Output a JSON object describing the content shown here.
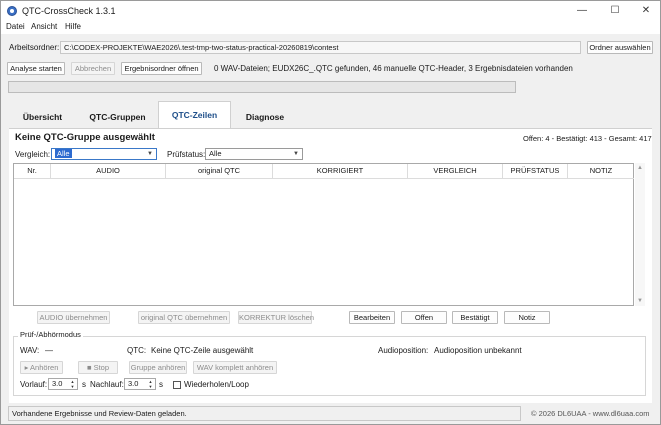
{
  "window": {
    "title": "QTC-CrossCheck 1.3.1",
    "controls": {
      "minimize": "—",
      "maximize": "☐",
      "close": "✕"
    }
  },
  "menu": [
    "Datei",
    "Ansicht",
    "Hilfe"
  ],
  "workdir": {
    "label": "Arbeitsordner:",
    "path": "C:\\CODEX-PROJEKTE\\WAE2026\\.test-tmp-two-status-practical-20260819\\contest",
    "choose_button": "Ordner auswählen"
  },
  "toolbar": {
    "start": "Analyse starten",
    "cancel": "Abbrechen",
    "open_results": "Ergebnisordner öffnen",
    "summary": "0 WAV-Dateien; EUDX26C_.QTC gefunden, 46 manuelle QTC-Header, 3 Ergebnisdateien vorhanden"
  },
  "progress": {
    "value": 0
  },
  "tabs": [
    {
      "label": "Übersicht",
      "active": false
    },
    {
      "label": "QTC-Gruppen",
      "active": false
    },
    {
      "label": "QTC-Zeilen",
      "active": true
    },
    {
      "label": "Diagnose",
      "active": false
    }
  ],
  "panel": {
    "heading": "Keine QTC-Gruppe ausgewählt",
    "counts": "Offen: 4 - Bestätigt: 413 - Gesamt: 417",
    "filter": {
      "compare_label": "Vergleich:",
      "compare_value": "Alle",
      "status_label": "Prüfstatus:",
      "status_value": "Alle"
    },
    "columns": [
      "Nr.",
      "AUDIO",
      "original QTC",
      "KORRIGIERT",
      "VERGLEICH",
      "PRÜFSTATUS",
      "NOTIZ"
    ],
    "rows": []
  },
  "actions": {
    "take_audio": "AUDIO übernehmen",
    "take_original": "original QTC übernehmen",
    "clear_correction": "KORREKTUR löschen",
    "edit": "Bearbeiten",
    "open": "Offen",
    "confirm": "Bestätigt",
    "note": "Notiz"
  },
  "listen": {
    "group_title": "Prüf-/Abhörmodus",
    "wav_label": "WAV:",
    "wav_value": "—",
    "qtc_label": "QTC:",
    "qtc_value": "Keine QTC-Zeile ausgewählt",
    "audiopos_label": "Audioposition:",
    "audiopos_value": "Audioposition unbekannt",
    "play": "Anhören",
    "stop": "Stop",
    "play_group": "Gruppe anhören",
    "play_wav": "WAV komplett anhören",
    "pre_label": "Vorlauf:",
    "pre_value": "3.0",
    "pre_unit": "s",
    "post_label": "Nachlauf:",
    "post_value": "3.0",
    "post_unit": "s",
    "repeat_label": "Wiederholen/Loop",
    "repeat_checked": false
  },
  "status": {
    "message": "Vorhandene Ergebnisse und Review-Daten geladen.",
    "copyright": "© 2026 DL6UAA - www.dl6uaa.com"
  }
}
